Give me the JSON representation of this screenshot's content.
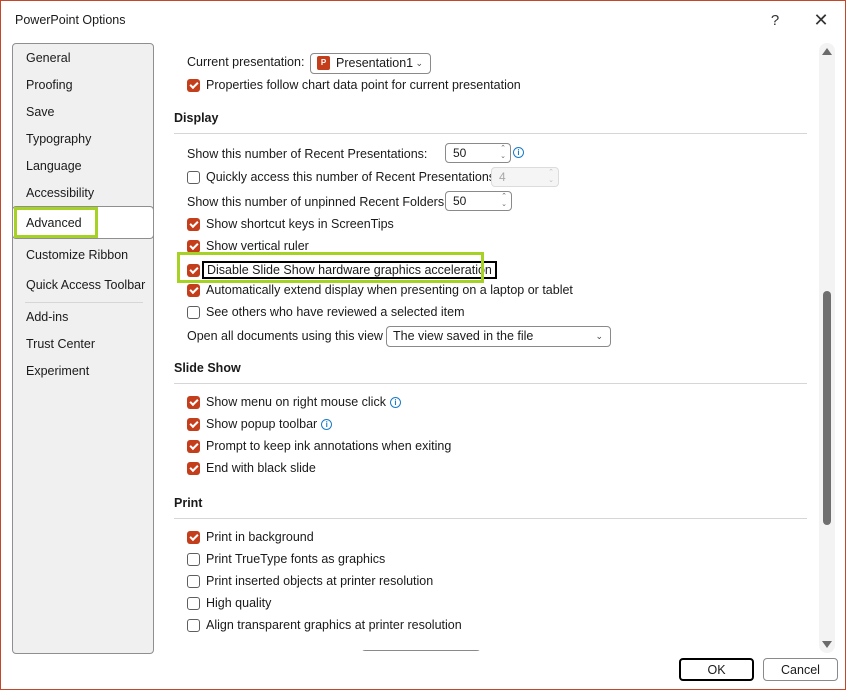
{
  "window": {
    "title": "PowerPoint Options",
    "help_label": "?",
    "close_label": "✕"
  },
  "sidebar": {
    "items": [
      {
        "label": "General"
      },
      {
        "label": "Proofing"
      },
      {
        "label": "Save"
      },
      {
        "label": "Typography"
      },
      {
        "label": "Language"
      },
      {
        "label": "Accessibility"
      },
      {
        "label": "Advanced",
        "selected": true
      },
      {
        "label": "Customize Ribbon"
      },
      {
        "label": "Quick Access Toolbar"
      },
      {
        "label": "Add-ins"
      },
      {
        "label": "Trust Center"
      },
      {
        "label": "Experiment"
      }
    ]
  },
  "chart_section": {
    "current_presentation_label": "Current presentation:",
    "current_presentation_value": "Presentation1",
    "file_icon_letter": "P",
    "properties_follow": {
      "label": "Properties follow chart data point for current presentation",
      "checked": true
    }
  },
  "display": {
    "heading": "Display",
    "recent_presentations_label": "Show this number of Recent Presentations:",
    "recent_presentations_value": "50",
    "quick_access": {
      "label": "Quickly access this number of Recent Presentations:",
      "checked": false,
      "value": "4"
    },
    "recent_folders_label": "Show this number of unpinned Recent Folders:",
    "recent_folders_value": "50",
    "shortcut_keys": {
      "label": "Show shortcut keys in ScreenTips",
      "checked": true
    },
    "vertical_ruler": {
      "label": "Show vertical ruler",
      "checked": true
    },
    "disable_hw_accel": {
      "label": "Disable Slide Show hardware graphics acceleration",
      "checked": true
    },
    "auto_extend": {
      "label": "Automatically extend display when presenting on a laptop or tablet",
      "checked": true
    },
    "see_others": {
      "label": "See others who have reviewed a selected item",
      "checked": false
    },
    "open_view_label": "Open all documents using this view",
    "open_view_value": "The view saved in the file"
  },
  "slide_show": {
    "heading": "Slide Show",
    "right_click_menu": {
      "label": "Show menu on right mouse click",
      "checked": true
    },
    "popup_toolbar": {
      "label": "Show popup toolbar",
      "checked": true
    },
    "keep_ink": {
      "label": "Prompt to keep ink annotations when exiting",
      "checked": true
    },
    "black_slide": {
      "label": "End with black slide",
      "checked": true
    }
  },
  "print": {
    "heading": "Print",
    "background": {
      "label": "Print in background",
      "checked": true
    },
    "truetype": {
      "label": "Print TrueType fonts as graphics",
      "checked": false
    },
    "inserted_objects": {
      "label": "Print inserted objects at printer resolution",
      "checked": false
    },
    "high_quality": {
      "label": "High quality",
      "checked": false
    },
    "align_transparent": {
      "label": "Align transparent graphics at printer resolution",
      "checked": false
    }
  },
  "footer": {
    "ok_label": "OK",
    "cancel_label": "Cancel"
  },
  "colors": {
    "accent": "#c43e1c",
    "highlight": "#a6d125",
    "info": "#1a7cc9"
  }
}
